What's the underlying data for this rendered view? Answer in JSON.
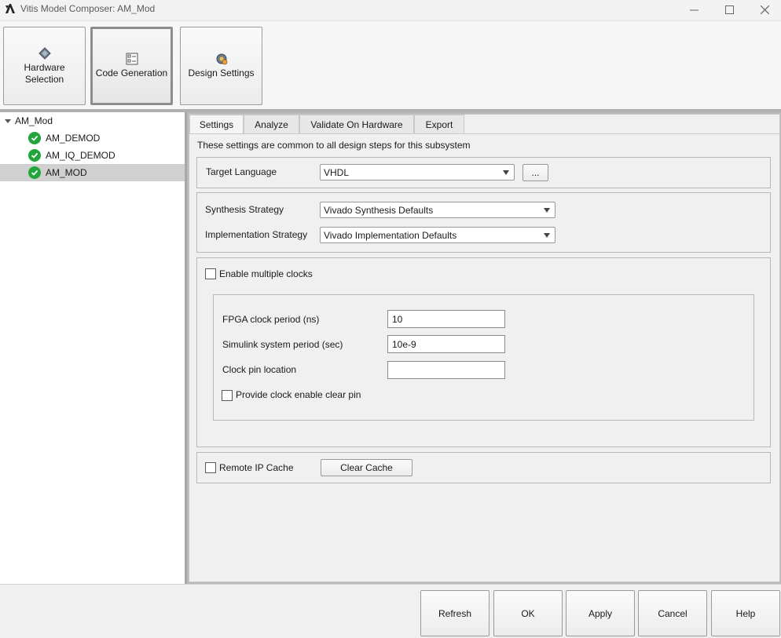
{
  "window": {
    "title": "Vitis Model Composer: AM_Mod",
    "minimize": "—",
    "maximize": "☐",
    "close": "✕"
  },
  "toolstrip": {
    "hardware_selection": "Hardware Selection",
    "code_generation": "Code Generation",
    "design_settings": "Design Settings",
    "active": "code_generation"
  },
  "tree": {
    "root": "AM_Mod",
    "items": [
      {
        "label": "AM_DEMOD",
        "status": "check-icon"
      },
      {
        "label": "AM_IQ_DEMOD",
        "status": "check-icon"
      },
      {
        "label": "AM_MOD",
        "status": "check-icon",
        "selected": true
      }
    ]
  },
  "tabs": [
    "Settings",
    "Analyze",
    "Validate On Hardware",
    "Export"
  ],
  "settings": {
    "description": "These settings are common to all design steps for this subsystem",
    "target_language_label": "Target Language",
    "target_language": "VHDL",
    "more_button": "...",
    "synthesis_label": "Synthesis Strategy",
    "synthesis_value": "Vivado Synthesis Defaults",
    "implementation_label": "Implementation Strategy",
    "implementation_value": "Vivado Implementation Defaults",
    "enable_multiple_clocks": "Enable multiple clocks",
    "fpga_clock_label": "FPGA clock period (ns)",
    "fpga_clock_value": "10",
    "simulink_period_label": "Simulink system period (sec)",
    "simulink_period_value": "10e-9",
    "clock_pin_label": "Clock pin location",
    "clock_pin_value": "",
    "clock_enable_clear": "Provide clock enable clear pin",
    "remote_ip_cache": "Remote IP Cache",
    "clear_cache": "Clear Cache"
  },
  "footer": {
    "refresh": "Refresh",
    "ok": "OK",
    "apply": "Apply",
    "cancel": "Cancel",
    "help": "Help"
  },
  "colors": {
    "check_green": "#22a53a",
    "selection": "#d0d0d0"
  }
}
